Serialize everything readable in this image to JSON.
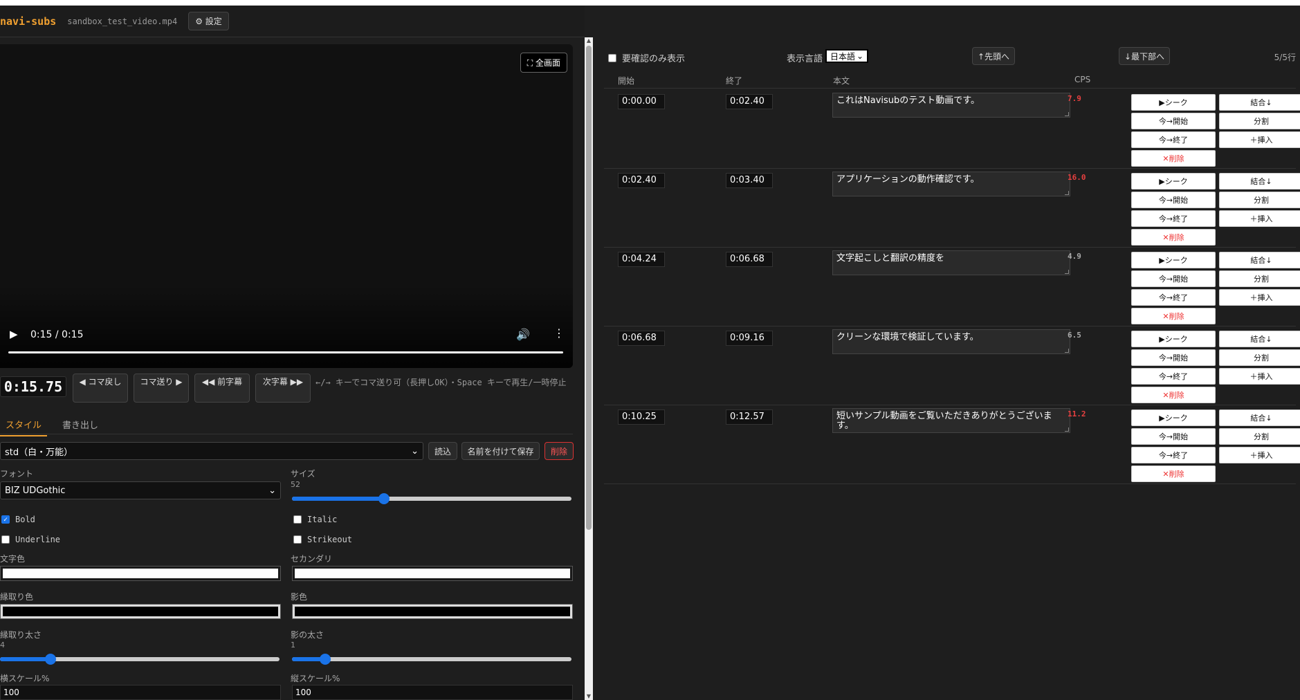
{
  "header": {
    "brand": "navi-subs",
    "filename": "sandbox_test_video.mp4",
    "settings_label": "⚙ 設定"
  },
  "video": {
    "fullscreen_label": "⛶ 全画面",
    "time_display": "0:15 / 0:15",
    "progress": 1.0
  },
  "player_nav": {
    "timecode": "0:15.75",
    "prev_frame": "◀ コマ戻し",
    "next_frame": "コマ送り ▶",
    "prev_sub": "◀◀ 前字幕",
    "next_sub": "次字幕 ▶▶",
    "hint": "←/→ キーでコマ送り可（長押しOK）・Space キーで再生/一時停止"
  },
  "style_tabs": {
    "style": "スタイル",
    "export": "書き出し"
  },
  "preset": {
    "selected": "std（白・万能）",
    "load": "読込",
    "save_as": "名前を付けて保存",
    "delete": "削除"
  },
  "style_form": {
    "font_label": "フォント",
    "font_value": "BIZ UDGothic",
    "size_label": "サイズ",
    "size_value": "52",
    "size_fraction": 0.33,
    "bold": "Bold",
    "italic": "Italic",
    "underline": "Underline",
    "strikeout": "Strikeout",
    "text_color_label": "文字色",
    "text_color": "#ffffff",
    "secondary_label": "セカンダリ",
    "secondary_color": "#ffffff",
    "outline_color_label": "縁取り色",
    "outline_color": "#000000",
    "shadow_color_label": "影色",
    "shadow_color": "#000000",
    "outline_width_label": "縁取り太さ",
    "outline_width_value": "4",
    "outline_fraction": 0.18,
    "shadow_width_label": "影の太さ",
    "shadow_width_value": "1",
    "shadow_fraction": 0.12,
    "scale_x_label": "横スケール%",
    "scale_x_value": "100",
    "scale_y_label": "縦スケール%",
    "scale_y_value": "100"
  },
  "subs_toolbar": {
    "needs_review_label": "要確認のみ表示",
    "lang_label": "表示言語",
    "lang_value": "日本語",
    "to_top": "↑先頭へ",
    "to_bottom": "↓最下部へ",
    "row_count": "5/5行"
  },
  "columns": {
    "start": "開始",
    "end": "終了",
    "text": "本文",
    "cps": "CPS"
  },
  "row_actions": {
    "seek": "▶シーク",
    "merge": "結合↓",
    "now_start": "今→開始",
    "split": "分割",
    "now_end": "今→終了",
    "insert": "＋挿入",
    "delete": "✕削除"
  },
  "rows": [
    {
      "start": "0:00.00",
      "end": "0:02.40",
      "text": "これはNavisubのテスト動画です。",
      "cps": "7.9",
      "cps_color": "#e84040"
    },
    {
      "start": "0:02.40",
      "end": "0:03.40",
      "text": "アプリケーションの動作確認です。",
      "cps": "16.0",
      "cps_color": "#e84040"
    },
    {
      "start": "0:04.24",
      "end": "0:06.68",
      "text": "文字起こしと翻訳の精度を",
      "cps": "4.9",
      "cps_color": "#aaaaaa"
    },
    {
      "start": "0:06.68",
      "end": "0:09.16",
      "text": "クリーンな環境で検証しています。",
      "cps": "6.5",
      "cps_color": "#aaaaaa"
    },
    {
      "start": "0:10.25",
      "end": "0:12.57",
      "text": "短いサンプル動画をご覧いただきありがとうございます。",
      "cps": "11.2",
      "cps_color": "#e84040"
    }
  ]
}
